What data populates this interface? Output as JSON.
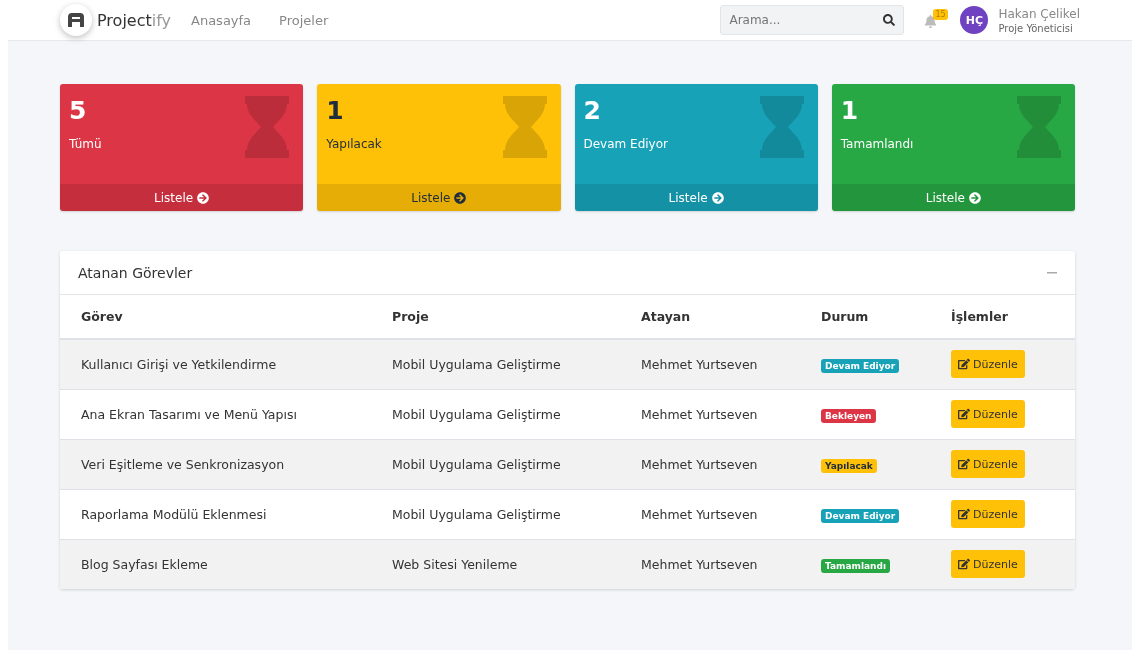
{
  "header": {
    "brand": {
      "text": "Project",
      "suffix": "ify"
    },
    "nav": [
      {
        "label": "Anasayfa"
      },
      {
        "label": "Projeler"
      }
    ],
    "search": {
      "placeholder": "Arama..."
    },
    "notifications": {
      "count": "15"
    },
    "user": {
      "initials": "HÇ",
      "name": "Hakan Çelikel",
      "role": "Proje Yöneticisi"
    }
  },
  "stat_cards": [
    {
      "value": "5",
      "label": "Tümü",
      "link": "Listele",
      "color": "#dc3545"
    },
    {
      "value": "1",
      "label": "Yapılacak",
      "link": "Listele",
      "color": "#ffc107"
    },
    {
      "value": "2",
      "label": "Devam Ediyor",
      "link": "Listele",
      "color": "#17a2b8"
    },
    {
      "value": "1",
      "label": "Tamamlandı",
      "link": "Listele",
      "color": "#28a745"
    }
  ],
  "table": {
    "title": "Atanan Görevler",
    "columns": [
      "Görev",
      "Proje",
      "Atayan",
      "Durum",
      "İşlemler"
    ],
    "rows": [
      {
        "task": "Kullanıcı Girişi ve Yetkilendirme",
        "project": "Mobil Uygulama Geliştirme",
        "assigner": "Mehmet Yurtseven",
        "status": {
          "text": "Devam Ediyor",
          "color": "#17a2b8"
        },
        "action": "Düzenle"
      },
      {
        "task": "Ana Ekran Tasarımı ve Menü Yapısı",
        "project": "Mobil Uygulama Geliştirme",
        "assigner": "Mehmet Yurtseven",
        "status": {
          "text": "Bekleyen",
          "color": "#dc3545"
        },
        "action": "Düzenle"
      },
      {
        "task": "Veri Eşitleme ve Senkronizasyon",
        "project": "Mobil Uygulama Geliştirme",
        "assigner": "Mehmet Yurtseven",
        "status": {
          "text": "Yapılacak",
          "color": "#ffc107"
        },
        "action": "Düzenle"
      },
      {
        "task": "Raporlama Modülü Eklenmesi",
        "project": "Mobil Uygulama Geliştirme",
        "assigner": "Mehmet Yurtseven",
        "status": {
          "text": "Devam Ediyor",
          "color": "#17a2b8"
        },
        "action": "Düzenle"
      },
      {
        "task": "Blog Sayfası Ekleme",
        "project": "Web Sitesi Yenileme",
        "assigner": "Mehmet Yurtseven",
        "status": {
          "text": "Tamamlandı",
          "color": "#28a745"
        },
        "action": "Düzenle"
      }
    ]
  }
}
